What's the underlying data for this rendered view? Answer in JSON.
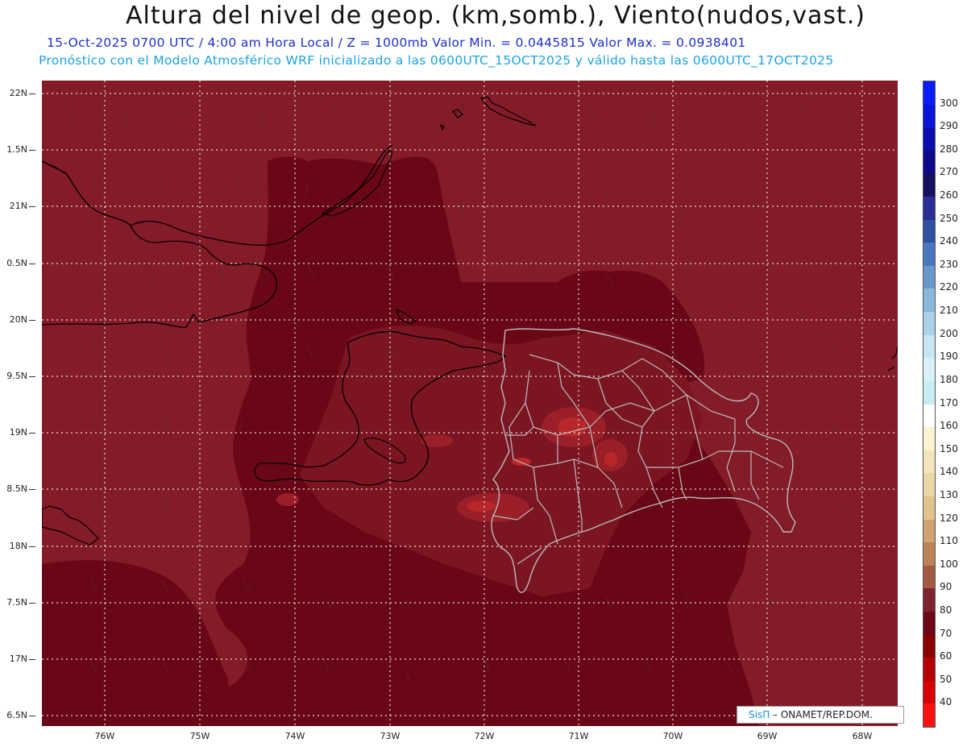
{
  "header": {
    "title": "Altura del nivel de geop. (km,somb.), Viento(nudos,vast.)",
    "subtitle_1": "15-Oct-2025  0700 UTC / 4:00 am Hora Local / Z = 1000mb Valor Min. = 0.0445815  Valor Max. = 0.0938401",
    "subtitle_2": "Pronóstico con el Modelo Atmosférico WRF inicializado a las 0600UTC_15OCT2025 y válido hasta las  0600UTC_17OCT2025"
  },
  "map": {
    "latitude_labels": [
      "22N",
      "1.5N",
      "21N",
      "0.5N",
      "20N",
      "9.5N",
      "19N",
      "8.5N",
      "18N",
      "7.5N",
      "17N",
      "6.5N"
    ],
    "longitude_labels": [
      "76W",
      "75W",
      "74W",
      "73W",
      "72W",
      "71W",
      "70W",
      "69W",
      "68W"
    ],
    "grid_style": "dotted white",
    "land_outline_color": "#000000",
    "border_color": "#bbbbbb",
    "colors": {
      "background_field": "#831b28",
      "dark_field": "#6a0716",
      "high_field": "#a0202a",
      "peak_field": "#c0302c"
    }
  },
  "colorbar": {
    "labels": [
      "300",
      "290",
      "280",
      "270",
      "260",
      "250",
      "240",
      "230",
      "220",
      "210",
      "200",
      "190",
      "180",
      "170",
      "160",
      "150",
      "140",
      "130",
      "120",
      "110",
      "100",
      "90",
      "80",
      "70",
      "60",
      "50",
      "40"
    ],
    "colors": [
      "#0a1cff",
      "#0a14d8",
      "#0a0eb0",
      "#0c0a88",
      "#161060",
      "#2a2e96",
      "#3050a0",
      "#4a78bc",
      "#6898c8",
      "#8ab8dc",
      "#abd2e8",
      "#c8e6f2",
      "#daf0f8",
      "#c8eef4",
      "#ffffff",
      "#fbf3d2",
      "#f3e6bc",
      "#ebd6a6",
      "#e0c28c",
      "#d0a270",
      "#bc8456",
      "#a45a42",
      "#7e2430",
      "#6e0818",
      "#8a0000",
      "#b40000",
      "#d80000",
      "#ff1010"
    ]
  },
  "credit": {
    "brand": "SisΠ",
    "org": " – ONAMET/REP.DOM."
  }
}
